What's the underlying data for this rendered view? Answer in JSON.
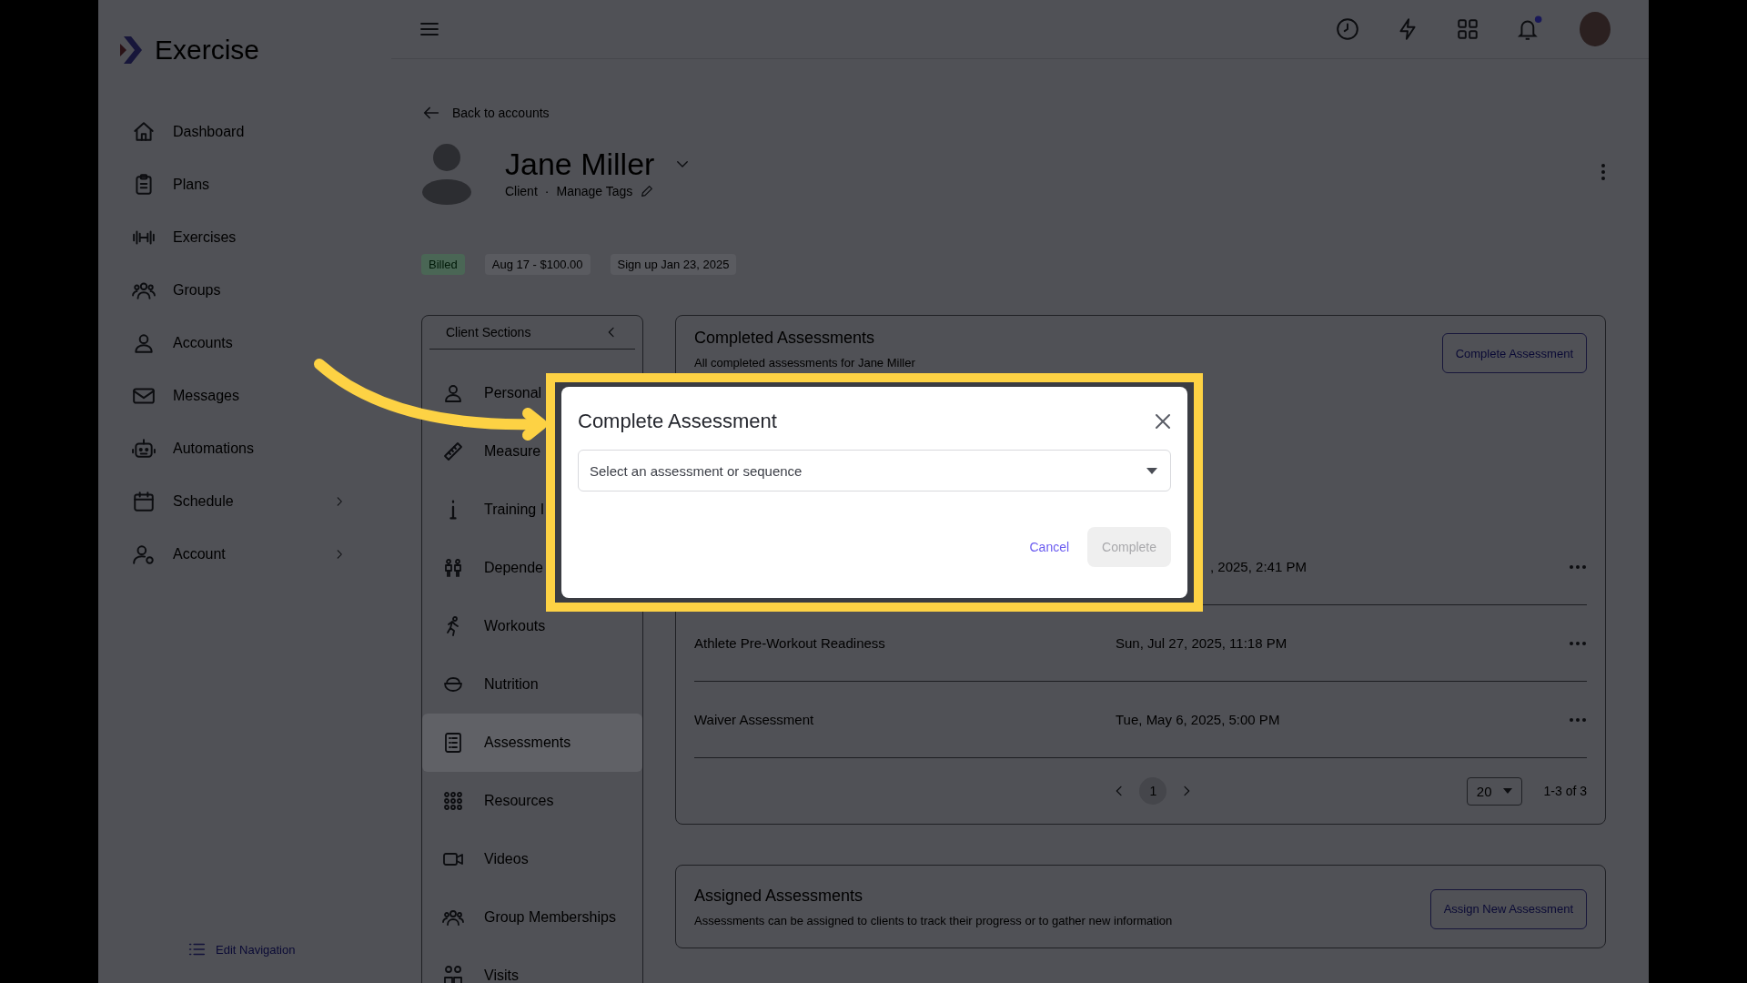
{
  "sidebar": {
    "logo": "Exercise",
    "items": [
      {
        "label": "Dashboard",
        "expandable": false
      },
      {
        "label": "Plans",
        "expandable": false
      },
      {
        "label": "Exercises",
        "expandable": false
      },
      {
        "label": "Groups",
        "expandable": false
      },
      {
        "label": "Accounts",
        "expandable": false
      },
      {
        "label": "Messages",
        "expandable": false
      },
      {
        "label": "Automations",
        "expandable": false
      },
      {
        "label": "Schedule",
        "expandable": true
      },
      {
        "label": "Account",
        "expandable": true
      }
    ],
    "edit_navigation": "Edit Navigation"
  },
  "profile": {
    "back_link": "Back to accounts",
    "name": "Jane Miller",
    "role": "Client",
    "separator": "·",
    "tags_link": "Manage Tags",
    "chips": [
      {
        "label": "Billed",
        "kind": "status"
      },
      {
        "label": "Aug 17 - $100.00",
        "kind": "info"
      },
      {
        "label": "Sign up Jan 23, 2025",
        "kind": "info"
      }
    ]
  },
  "client_sections": {
    "title": "Client Sections",
    "items": [
      {
        "label": "Personal",
        "selected": false
      },
      {
        "label": "Measure",
        "selected": false
      },
      {
        "label": "Training I",
        "selected": false
      },
      {
        "label": "Depende",
        "selected": false
      },
      {
        "label": "Workouts",
        "selected": false
      },
      {
        "label": "Nutrition",
        "selected": false
      },
      {
        "label": "Assessments",
        "selected": true
      },
      {
        "label": "Resources",
        "selected": false
      },
      {
        "label": "Videos",
        "selected": false
      },
      {
        "label": "Group Memberships",
        "selected": false
      },
      {
        "label": "Visits",
        "selected": false
      }
    ]
  },
  "completed": {
    "title": "Completed Assessments",
    "subtitle": "All completed assessments for Jane Miller",
    "button": "Complete Assessment",
    "rows": [
      {
        "date": ", 2025, 2:41 PM"
      },
      {
        "name": "Athlete Pre-Workout Readiness",
        "date": "Sun, Jul 27, 2025, 11:18 PM"
      },
      {
        "name": "Waiver Assessment",
        "date": "Tue, May 6, 2025, 5:00 PM"
      }
    ],
    "pagination": {
      "pages": [
        {
          "label": "1",
          "selected": true
        }
      ],
      "per_page": "20",
      "range": "1-3 of 3"
    }
  },
  "assigned": {
    "title": "Assigned Assessments",
    "subtitle": "Assessments can be assigned to clients to track their progress or to gather new information",
    "button": "Assign New Assessment"
  },
  "modal": {
    "title": "Complete Assessment",
    "select_placeholder": "Select an assessment or sequence",
    "cancel": "Cancel",
    "complete": "Complete",
    "complete_disabled": true
  }
}
